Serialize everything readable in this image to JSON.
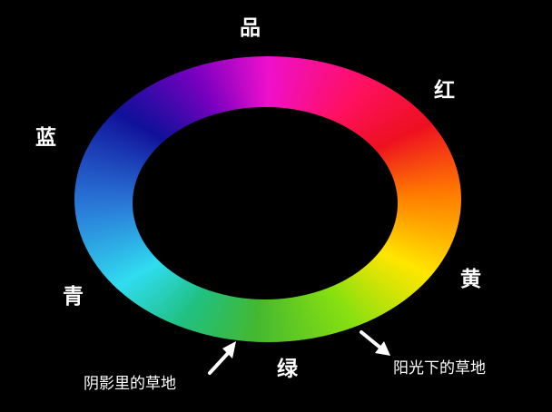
{
  "colors": {
    "background": "#000000",
    "text": "#ffffff",
    "magenta": "#ee10cc",
    "red": "#ee1020",
    "yellow": "#ffe600",
    "green": "#44b830",
    "cyan": "#30dcf0",
    "blue": "#10109a"
  },
  "wheel": {
    "labels": {
      "magenta": "品",
      "red": "红",
      "yellow": "黄",
      "green": "绿",
      "cyan": "青",
      "blue": "蓝"
    }
  },
  "annotations": {
    "shadow_grass": "阴影里的草地",
    "sunlit_grass": "阳光下的草地"
  }
}
